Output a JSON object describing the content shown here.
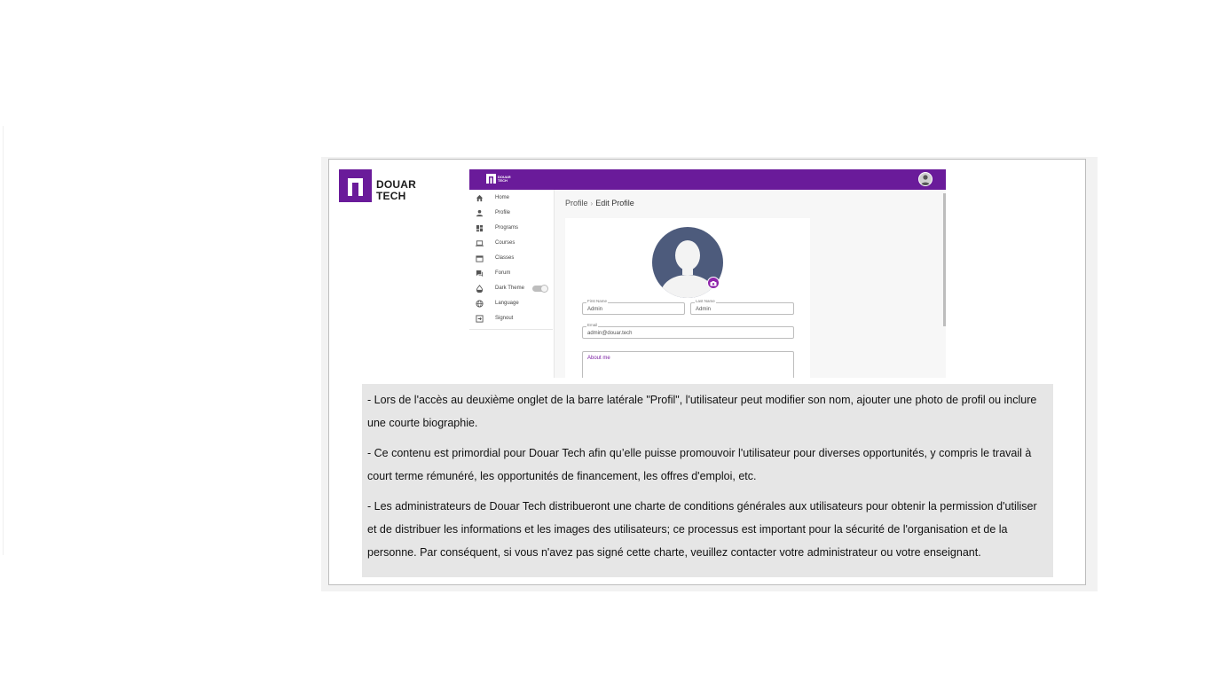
{
  "brand": {
    "logo_text_line1": "DOUAR",
    "logo_text_line2": "TECH",
    "primary_color": "#6a1b9a"
  },
  "app": {
    "topbar": {
      "logo_text_line1": "DOUAR",
      "logo_text_line2": "TECH",
      "avatar_icon": "user-avatar-icon"
    },
    "sidebar": {
      "items": [
        {
          "label": "Home",
          "icon": "home-icon"
        },
        {
          "label": "Profile",
          "icon": "person-icon"
        },
        {
          "label": "Programs",
          "icon": "dashboard-icon"
        },
        {
          "label": "Courses",
          "icon": "laptop-icon"
        },
        {
          "label": "Classes",
          "icon": "calendar-icon"
        },
        {
          "label": "Forum",
          "icon": "forum-icon"
        },
        {
          "label": "Dark Theme",
          "icon": "contrast-icon",
          "toggle": "off"
        },
        {
          "label": "Language",
          "icon": "globe-icon"
        },
        {
          "label": "Signout",
          "icon": "signout-icon"
        }
      ]
    },
    "breadcrumb": {
      "parent": "Profile",
      "separator": "›",
      "current": "Edit Profile"
    },
    "form": {
      "first_name": {
        "label": "First Name",
        "value": "Admin"
      },
      "last_name": {
        "label": "Last Name",
        "value": "Admin"
      },
      "email": {
        "label": "Email",
        "value": "admin@douar.tech"
      },
      "about": {
        "placeholder": "About me"
      }
    }
  },
  "description": {
    "paragraphs": [
      "- Lors de l'accès au deuxième onglet de la barre latérale \"Profil\", l'utilisateur peut modifier son nom, ajouter une photo de profil ou inclure une courte biographie.",
      "- Ce contenu est primordial pour Douar Tech afin qu’elle puisse promouvoir l'utilisateur pour diverses opportunités, y compris le travail à court terme rémunéré, les opportunités de financement, les offres d'emploi, etc.",
      "- Les administrateurs de Douar Tech distribueront une charte de conditions générales aux utilisateurs pour obtenir la permission d'utiliser et de distribuer les informations et les images des utilisateurs; ce processus est important pour la sécurité de l'organisation et de la personne. Par conséquent, si vous n'avez pas signé cette charte, veuillez contacter votre administrateur ou votre enseignant."
    ]
  }
}
